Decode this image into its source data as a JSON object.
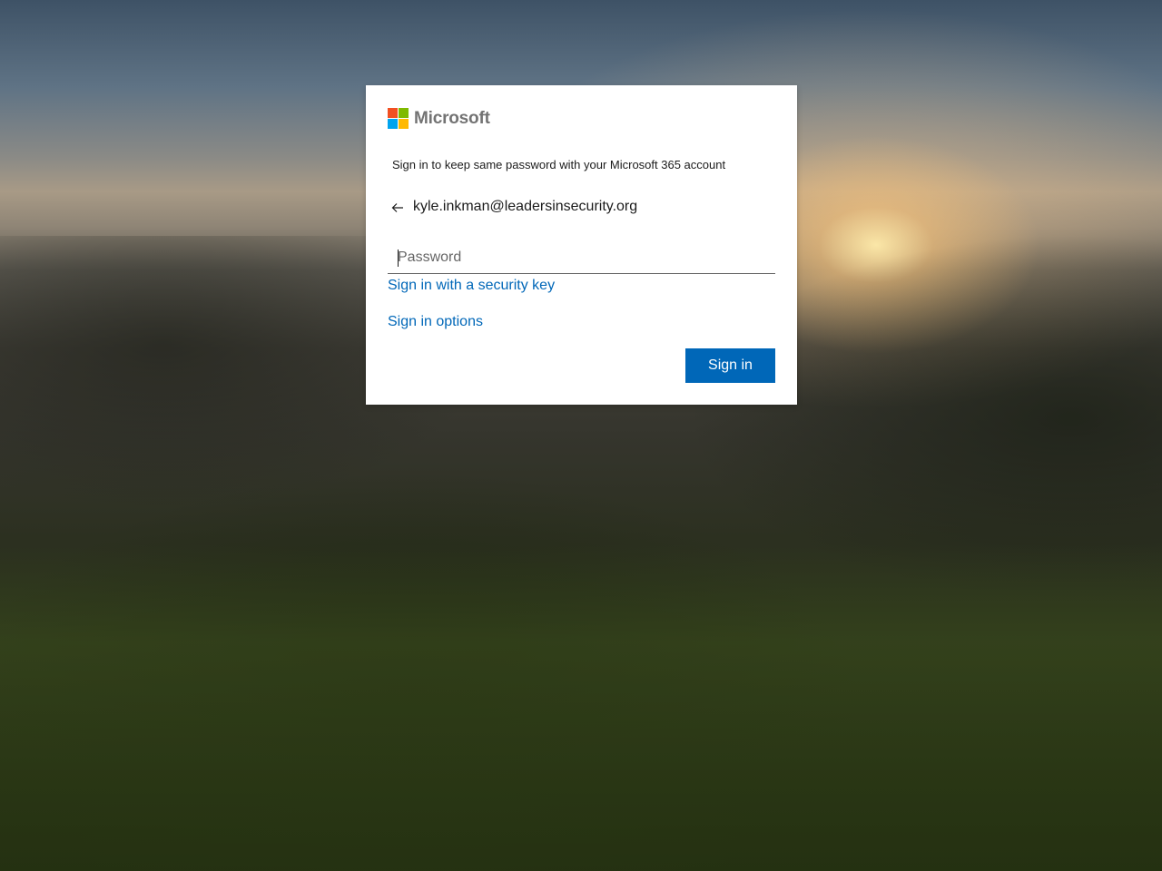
{
  "background": {
    "description_name": "landscape-background"
  },
  "card": {
    "logo": {
      "text": "Microsoft",
      "colors": [
        "#f25022",
        "#7fba00",
        "#00a4ef",
        "#ffb900"
      ]
    },
    "subtitle": "Sign in to keep same password with your Microsoft 365 account",
    "identity": {
      "back_icon": "arrow-left-icon",
      "email": "kyle.inkman@leadersinsecurity.org"
    },
    "password": {
      "placeholder": "Password",
      "value": ""
    },
    "links": {
      "security_key": "Sign in with a security key",
      "options": "Sign in options"
    },
    "signin_button": "Sign in"
  },
  "colors": {
    "accent": "#0067b8",
    "text": "#1b1b1b",
    "card_bg": "#ffffff"
  }
}
